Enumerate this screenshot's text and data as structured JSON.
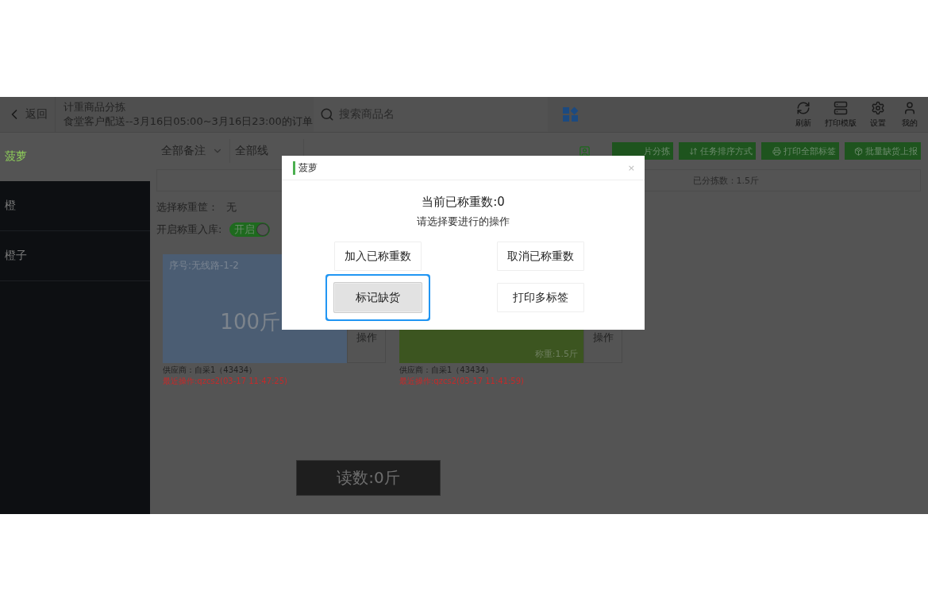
{
  "header": {
    "back": "返回",
    "title": "计重商品分拣",
    "subtitle": "食堂客户配送--3月16日05:00~3月16日23:00的订单",
    "search_placeholder": "搜索商品名",
    "tools": [
      {
        "label": "刷新"
      },
      {
        "label": "打印模版"
      },
      {
        "label": "设置"
      },
      {
        "label": "我的"
      }
    ]
  },
  "sidebar": {
    "items": [
      {
        "label": "菠萝",
        "selected": true
      },
      {
        "label": "橙",
        "selected": false
      },
      {
        "label": "橙子",
        "selected": false
      }
    ]
  },
  "filters": [
    {
      "label": "全部备注",
      "caret": true
    },
    {
      "label": "全部线",
      "caret": false
    }
  ],
  "actions": [
    {
      "label": "片分拣"
    },
    {
      "label": "任务排序方式"
    },
    {
      "label": "打印全部标签"
    },
    {
      "label": "批量缺货上报"
    }
  ],
  "sorted_count": "已分拣数：1.5斤",
  "basket": {
    "label": "选择称重筐：",
    "value": "无"
  },
  "stock_in": {
    "label": "开启称重入库:",
    "on": true,
    "switch_label": "开启"
  },
  "cards": [
    {
      "kind": "pending",
      "color": "#4b5d73",
      "serial": "序号:无线路-1-2",
      "amount": "100斤",
      "action": "操作",
      "supplier": "供应商：自采1（43434）",
      "last_op": "最近操作:qzcs2(03-17 11:47:25)"
    },
    {
      "kind": "weighed",
      "color": "#3c5520",
      "weight": "称重:1.5斤",
      "action": "操作",
      "supplier": "供应商：自采1（43434）",
      "last_op": "最近操作:qzcs2(03-17 11:41:59)"
    }
  ],
  "reading": "读数:0斤",
  "dialog": {
    "title": "菠萝",
    "current": "当前已称重数:0",
    "prompt": "请选择要进行的操作",
    "close": "×",
    "buttons": [
      {
        "label": "加入已称重数",
        "selected": false
      },
      {
        "label": "取消已称重数",
        "selected": false
      },
      {
        "label": "标记缺货",
        "selected": true
      },
      {
        "label": "打印多标签",
        "selected": false
      }
    ]
  }
}
